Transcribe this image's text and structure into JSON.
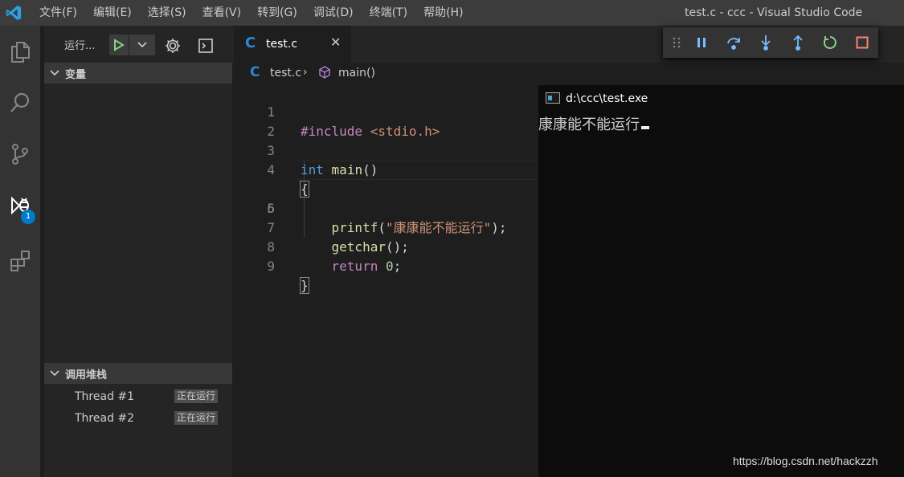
{
  "titlebar": {
    "menu": [
      "文件(F)",
      "编辑(E)",
      "选择(S)",
      "查看(V)",
      "转到(G)",
      "调试(D)",
      "终端(T)",
      "帮助(H)"
    ],
    "title": "test.c - ccc - Visual Studio Code"
  },
  "activitybar": {
    "items": [
      "files-icon",
      "search-icon",
      "source-control-icon",
      "debug-icon",
      "extensions-icon"
    ],
    "debug_badge": "1"
  },
  "sidebar": {
    "run_label": "运行...",
    "variables_header": "变量",
    "callstack_header": "调用堆栈",
    "threads": [
      {
        "name": "Thread #1",
        "status": "正在运行"
      },
      {
        "name": "Thread #2",
        "status": "正在运行"
      }
    ]
  },
  "editor": {
    "tab_icon": "C",
    "tab_label": "test.c",
    "breadcrumb": {
      "file": "test.c",
      "symbol": "main()"
    },
    "line_numbers": [
      "1",
      "2",
      "3",
      "4",
      "5",
      "6",
      "7",
      "8",
      "9"
    ],
    "code": {
      "l1_directive": "#include",
      "l1_header": "<stdio.h>",
      "l3_type": "int",
      "l3_func": "main",
      "l3_parens": "()",
      "l4_brace": "{",
      "l5_func": "printf",
      "l5_open": "(",
      "l5_str": "\"康康能不能运行\"",
      "l5_close": ");",
      "l7_func": "getchar",
      "l7_rest": "();",
      "l8_kw": "return",
      "l8_num": "0",
      "l8_semi": ";",
      "l9_brace": "}"
    }
  },
  "console": {
    "title": "d:\\ccc\\test.exe",
    "output": "康康能不能运行"
  },
  "watermark": "https://blog.csdn.net/hackzzh",
  "colors": {
    "accent": "#007acc",
    "continue_green": "#89d185",
    "stop_red": "#f48771",
    "step_blue": "#75beff"
  }
}
